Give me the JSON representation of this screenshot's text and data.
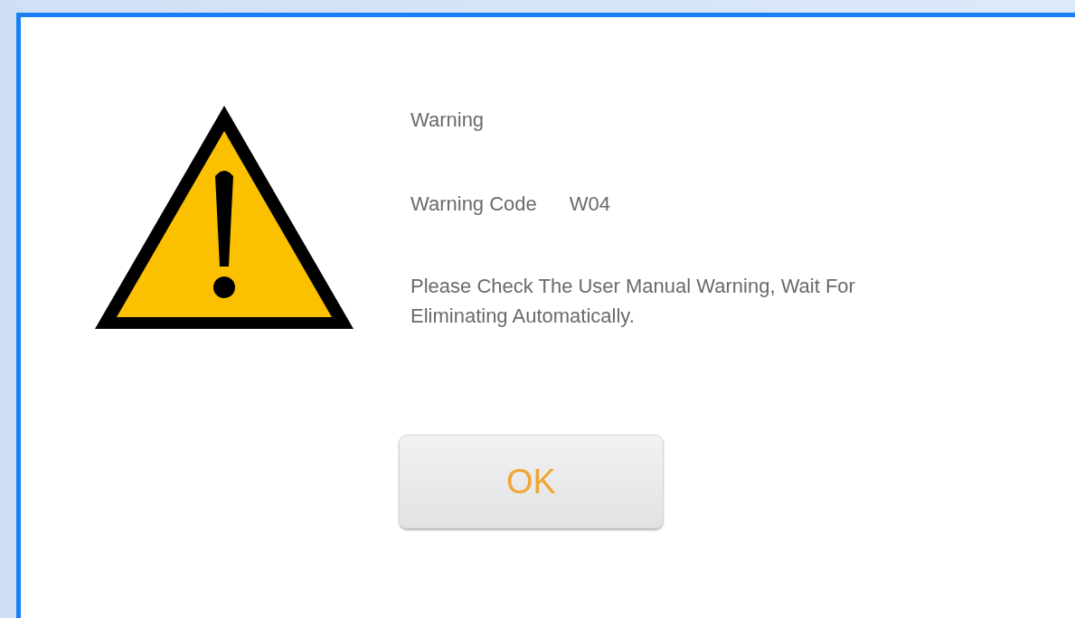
{
  "dialog": {
    "title": "Warning",
    "fields": [
      {
        "label": "Warning Code",
        "value": "W04"
      }
    ],
    "message": "Please Check The User Manual Warning, Wait For Eliminating Automatically.",
    "buttons": [
      {
        "label": "OK"
      }
    ]
  }
}
